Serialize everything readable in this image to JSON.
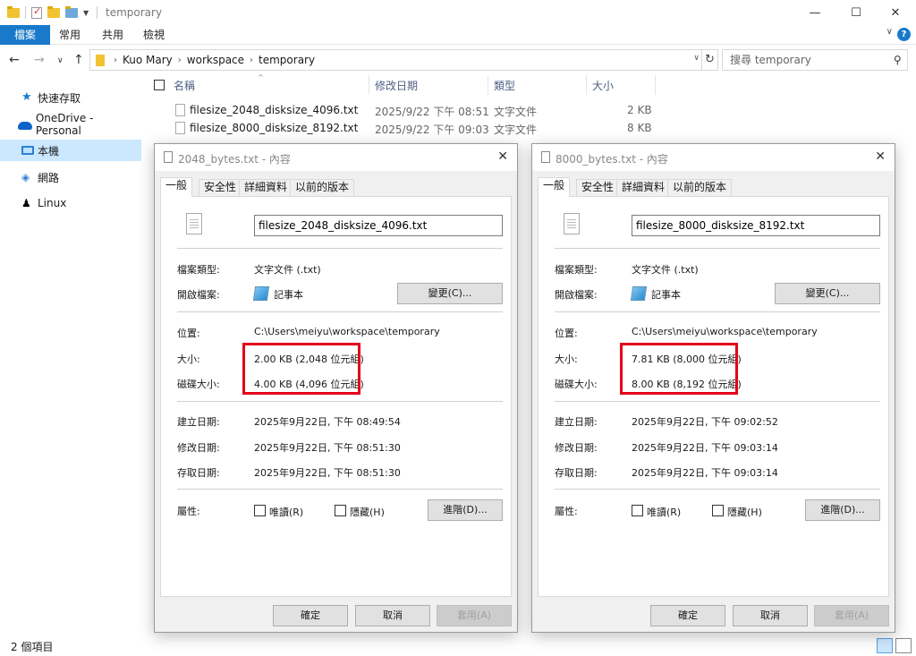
{
  "window": {
    "title": "temporary",
    "controls": {
      "minimize": "—",
      "maximize": "☐",
      "close": "✕"
    }
  },
  "ribbon": {
    "tabs": [
      "檔案",
      "常用",
      "共用",
      "檢視"
    ],
    "help": "?"
  },
  "nav": {
    "breadcrumbs": [
      "Kuo Mary",
      "workspace",
      "temporary"
    ],
    "search_placeholder": "搜尋 temporary"
  },
  "sidebar": {
    "items": [
      {
        "label": "快速存取",
        "icon": "star-icon"
      },
      {
        "label": "OneDrive - Personal",
        "icon": "cloud-icon"
      },
      {
        "label": "本機",
        "icon": "computer-icon",
        "selected": true
      },
      {
        "label": "網路",
        "icon": "network-icon"
      },
      {
        "label": "Linux",
        "icon": "penguin-icon"
      }
    ]
  },
  "file_list": {
    "columns": [
      "名稱",
      "修改日期",
      "類型",
      "大小"
    ],
    "rows": [
      {
        "name": "filesize_2048_disksize_4096.txt",
        "modified": "2025/9/22 下午 08:51",
        "type": "文字文件",
        "size": "2 KB"
      },
      {
        "name": "filesize_8000_disksize_8192.txt",
        "modified": "2025/9/22 下午 09:03",
        "type": "文字文件",
        "size": "8 KB"
      }
    ]
  },
  "status": {
    "item_count": "2 個項目"
  },
  "dialog_common": {
    "tabs": [
      "一般",
      "安全性",
      "詳細資料",
      "以前的版本"
    ],
    "labels": {
      "file_type": "檔案類型:",
      "opens_with": "開啟檔案:",
      "location": "位置:",
      "size": "大小:",
      "size_on_disk": "磁碟大小:",
      "created": "建立日期:",
      "modified": "修改日期:",
      "accessed": "存取日期:",
      "attributes": "屬性:"
    },
    "file_type_value": "文字文件 (.txt)",
    "app_name": "記事本",
    "change_button": "變更(C)...",
    "readonly_label": "唯讀(R)",
    "hidden_label": "隱藏(H)",
    "advanced_button": "進階(D)...",
    "ok_button": "確定",
    "cancel_button": "取消",
    "apply_button": "套用(A)",
    "location_value": "C:\\Users\\meiyu\\workspace\\temporary",
    "highlight_color": "#e3001b"
  },
  "dialogs": [
    {
      "title": "2048_bytes.txt - 內容",
      "filename": "filesize_2048_disksize_4096.txt",
      "size": "2.00 KB (2,048 位元組)",
      "size_on_disk": "4.00 KB (4,096 位元組)",
      "created": "2025年9月22日, 下午 08:49:54",
      "modified": "2025年9月22日, 下午 08:51:30",
      "accessed": "2025年9月22日, 下午 08:51:30"
    },
    {
      "title": "8000_bytes.txt - 內容",
      "filename": "filesize_8000_disksize_8192.txt",
      "size": "7.81 KB (8,000 位元組)",
      "size_on_disk": "8.00 KB (8,192 位元組)",
      "created": "2025年9月22日, 下午 09:02:52",
      "modified": "2025年9月22日, 下午 09:03:14",
      "accessed": "2025年9月22日, 下午 09:03:14"
    }
  ]
}
